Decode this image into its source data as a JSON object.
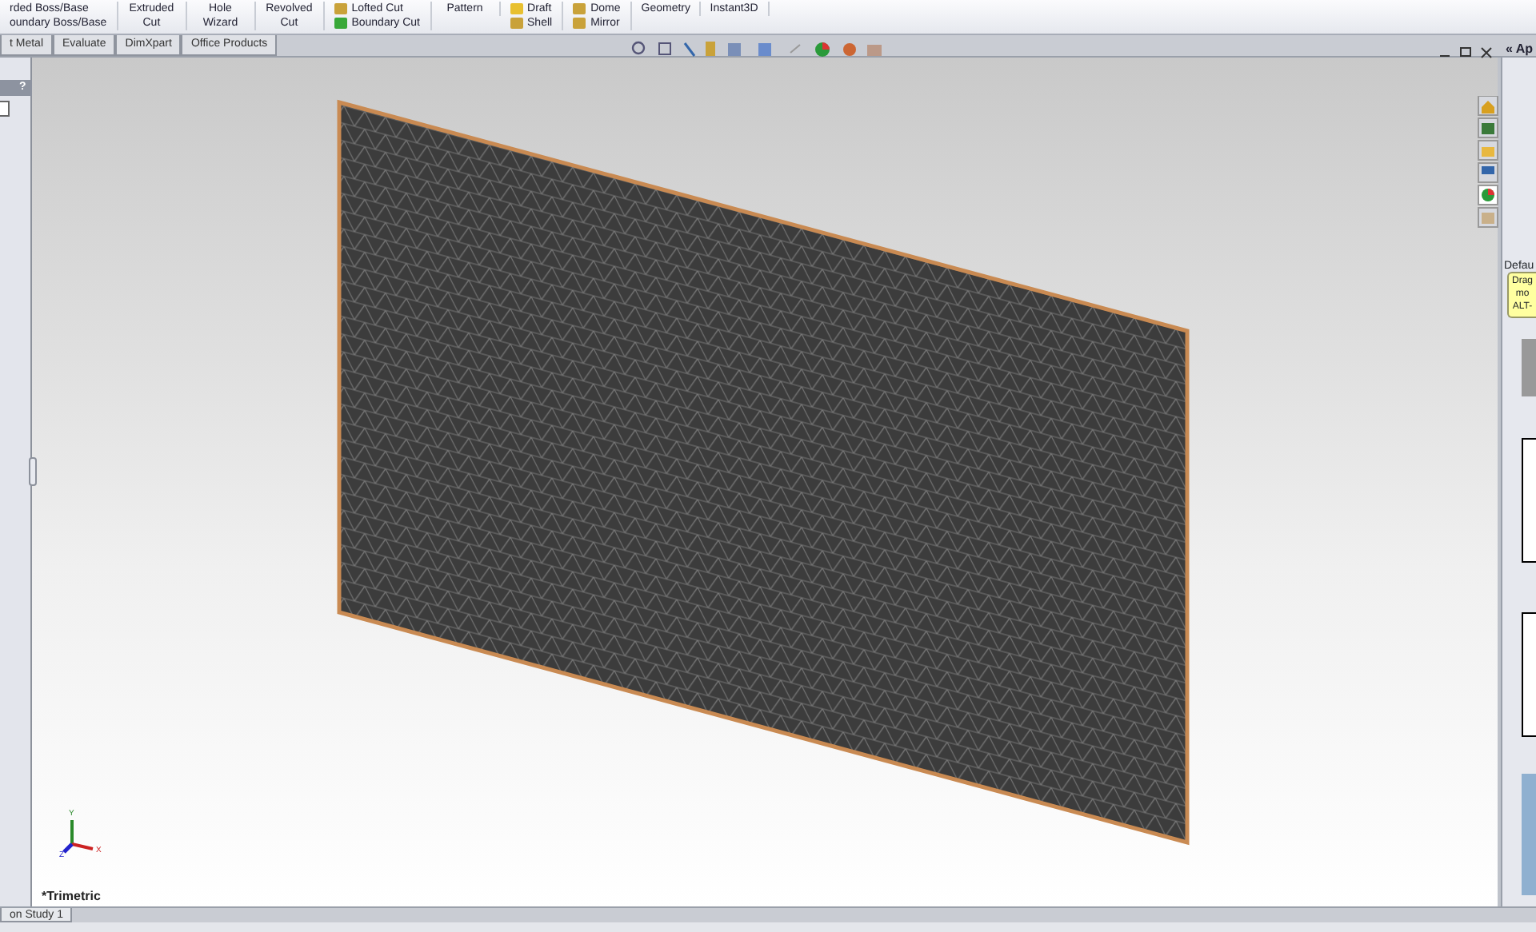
{
  "ribbon": {
    "groups": [
      {
        "kind": "stack",
        "items": [
          "rded Boss/Base",
          "oundary Boss/Base"
        ]
      },
      {
        "kind": "big",
        "items": [
          "Extruded Cut"
        ]
      },
      {
        "kind": "big",
        "items": [
          "Hole Wizard"
        ]
      },
      {
        "kind": "big",
        "items": [
          "Revolved Cut"
        ]
      },
      {
        "kind": "stack",
        "items": [
          "Lofted Cut",
          "Boundary Cut"
        ]
      },
      {
        "kind": "big",
        "items": [
          "Pattern"
        ]
      },
      {
        "kind": "stack",
        "items": [
          "Draft",
          "Shell"
        ]
      },
      {
        "kind": "stack",
        "items": [
          "Dome",
          "Mirror"
        ]
      },
      {
        "kind": "big",
        "items": [
          "Geometry"
        ]
      },
      {
        "kind": "big",
        "items": [
          "Instant3D"
        ]
      }
    ]
  },
  "tabs": [
    {
      "label": "t Metal"
    },
    {
      "label": "Evaluate"
    },
    {
      "label": "DimXpart"
    },
    {
      "label": "Office Products"
    }
  ],
  "left_panel": {
    "help": "?"
  },
  "viewport": {
    "view_name": "*Trimetric",
    "axes": [
      "X",
      "Y",
      "Z"
    ]
  },
  "task_pane": {
    "header": "« Ap",
    "section": "Defau",
    "tooltip": [
      "Drag",
      "mo",
      "ALT-"
    ]
  },
  "bottom_tabs": [
    {
      "label": "on Study 1"
    }
  ]
}
